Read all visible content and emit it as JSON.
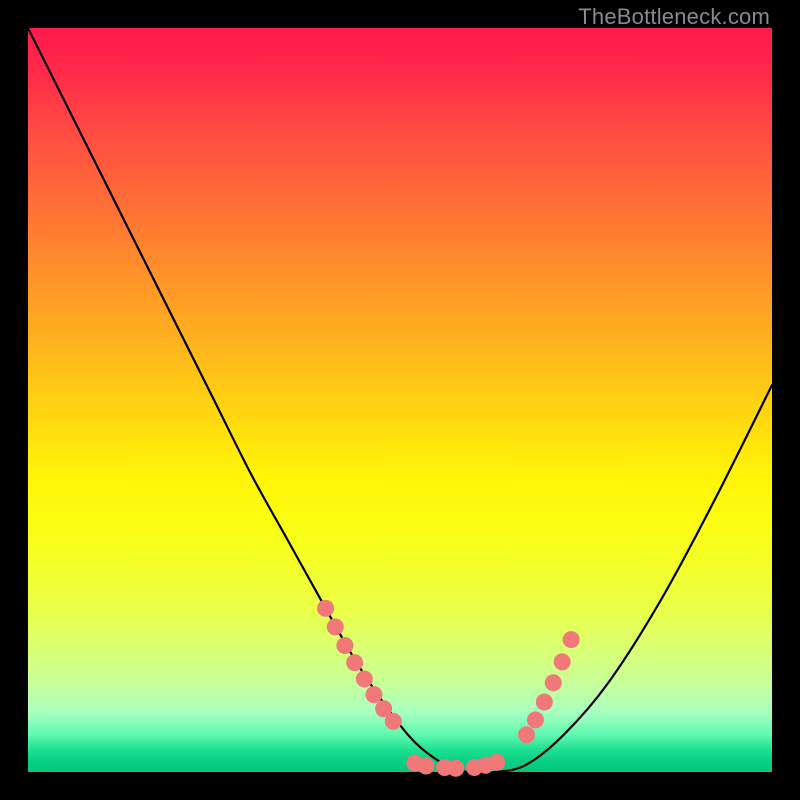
{
  "watermark": "TheBottleneck.com",
  "colors": {
    "background": "#000000",
    "gradient_top": "#ff1a4d",
    "gradient_mid": "#ffde0e",
    "gradient_bottom": "#00c878",
    "curve_stroke": "#000000",
    "marker_fill": "#f07878",
    "watermark_text": "#8a8a8a"
  },
  "chart_data": {
    "type": "line",
    "title": "",
    "xlabel": "",
    "ylabel": "",
    "xlim": [
      0,
      100
    ],
    "ylim": [
      0,
      100
    ],
    "grid": false,
    "legend": false,
    "series": [
      {
        "name": "curve",
        "x": [
          0,
          5,
          10,
          15,
          20,
          25,
          30,
          35,
          40,
          44,
          48,
          52,
          56,
          59,
          63,
          67,
          72,
          78,
          85,
          92,
          100
        ],
        "y": [
          100,
          90,
          80,
          70,
          60,
          50,
          40,
          31,
          22,
          15,
          9,
          4,
          1,
          0,
          0,
          1,
          5,
          12,
          23,
          36,
          52
        ]
      }
    ],
    "markers": [
      {
        "x": 40.0,
        "y": 22.0
      },
      {
        "x": 41.3,
        "y": 19.5
      },
      {
        "x": 42.6,
        "y": 17.0
      },
      {
        "x": 43.9,
        "y": 14.7
      },
      {
        "x": 45.2,
        "y": 12.5
      },
      {
        "x": 46.5,
        "y": 10.4
      },
      {
        "x": 47.8,
        "y": 8.5
      },
      {
        "x": 49.1,
        "y": 6.8
      },
      {
        "x": 52.0,
        "y": 1.2
      },
      {
        "x": 53.5,
        "y": 0.8
      },
      {
        "x": 56.0,
        "y": 0.6
      },
      {
        "x": 57.5,
        "y": 0.5
      },
      {
        "x": 60.0,
        "y": 0.6
      },
      {
        "x": 61.5,
        "y": 0.9
      },
      {
        "x": 63.0,
        "y": 1.3
      },
      {
        "x": 67.0,
        "y": 5.0
      },
      {
        "x": 68.2,
        "y": 7.0
      },
      {
        "x": 69.4,
        "y": 9.4
      },
      {
        "x": 70.6,
        "y": 12.0
      },
      {
        "x": 71.8,
        "y": 14.8
      },
      {
        "x": 73.0,
        "y": 17.8
      }
    ]
  }
}
